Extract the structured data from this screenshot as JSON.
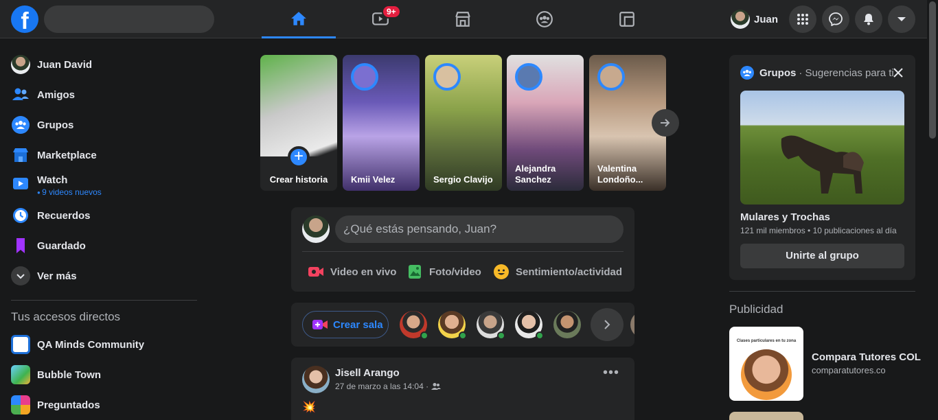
{
  "topbar": {
    "logo_letter": "f",
    "search_placeholder": "",
    "watch_badge": "9+",
    "profile_name": "Juan"
  },
  "sidebar": {
    "items": [
      {
        "label": "Juan David"
      },
      {
        "label": "Amigos"
      },
      {
        "label": "Grupos"
      },
      {
        "label": "Marketplace"
      },
      {
        "label": "Watch",
        "sub": "9 videos nuevos"
      },
      {
        "label": "Recuerdos"
      },
      {
        "label": "Guardado"
      },
      {
        "label": "Ver más"
      }
    ],
    "shortcuts_title": "Tus accesos directos",
    "shortcuts": [
      {
        "label": "QA Minds Community"
      },
      {
        "label": "Bubble Town"
      },
      {
        "label": "Preguntados"
      }
    ]
  },
  "stories": {
    "create_label": "Crear historia",
    "items": [
      {
        "name": "Kmii Velez"
      },
      {
        "name": "Sergio Clavijo"
      },
      {
        "name": "Alejandra Sanchez"
      },
      {
        "name": "Valentina Londoño..."
      }
    ]
  },
  "composer": {
    "placeholder": "¿Qué estás pensando, Juan?",
    "actions": [
      {
        "label": "Video en vivo"
      },
      {
        "label": "Foto/video"
      },
      {
        "label": "Sentimiento/actividad"
      }
    ]
  },
  "rooms": {
    "create_label": "Crear sala"
  },
  "post": {
    "author": "Jisell Arango",
    "meta": "27 de marzo a las 14:04 ·",
    "body": "💥"
  },
  "groups": {
    "title": "Grupos",
    "subtitle": "· Sugerencias para ti",
    "name": "Mulares y Trochas",
    "stats": "121 mil miembros • 10 publicaciones al día",
    "join_label": "Unirte al grupo"
  },
  "ads": {
    "title": "Publicidad",
    "image_caption": "Clases particulares en tu zona",
    "name": "Compara Tutores COL",
    "url": "comparatutores.co"
  },
  "colors": {
    "accent": "#2d88ff",
    "background": "#18191a",
    "surface": "#242526",
    "badge": "#e41e3f",
    "online": "#31a24c"
  }
}
